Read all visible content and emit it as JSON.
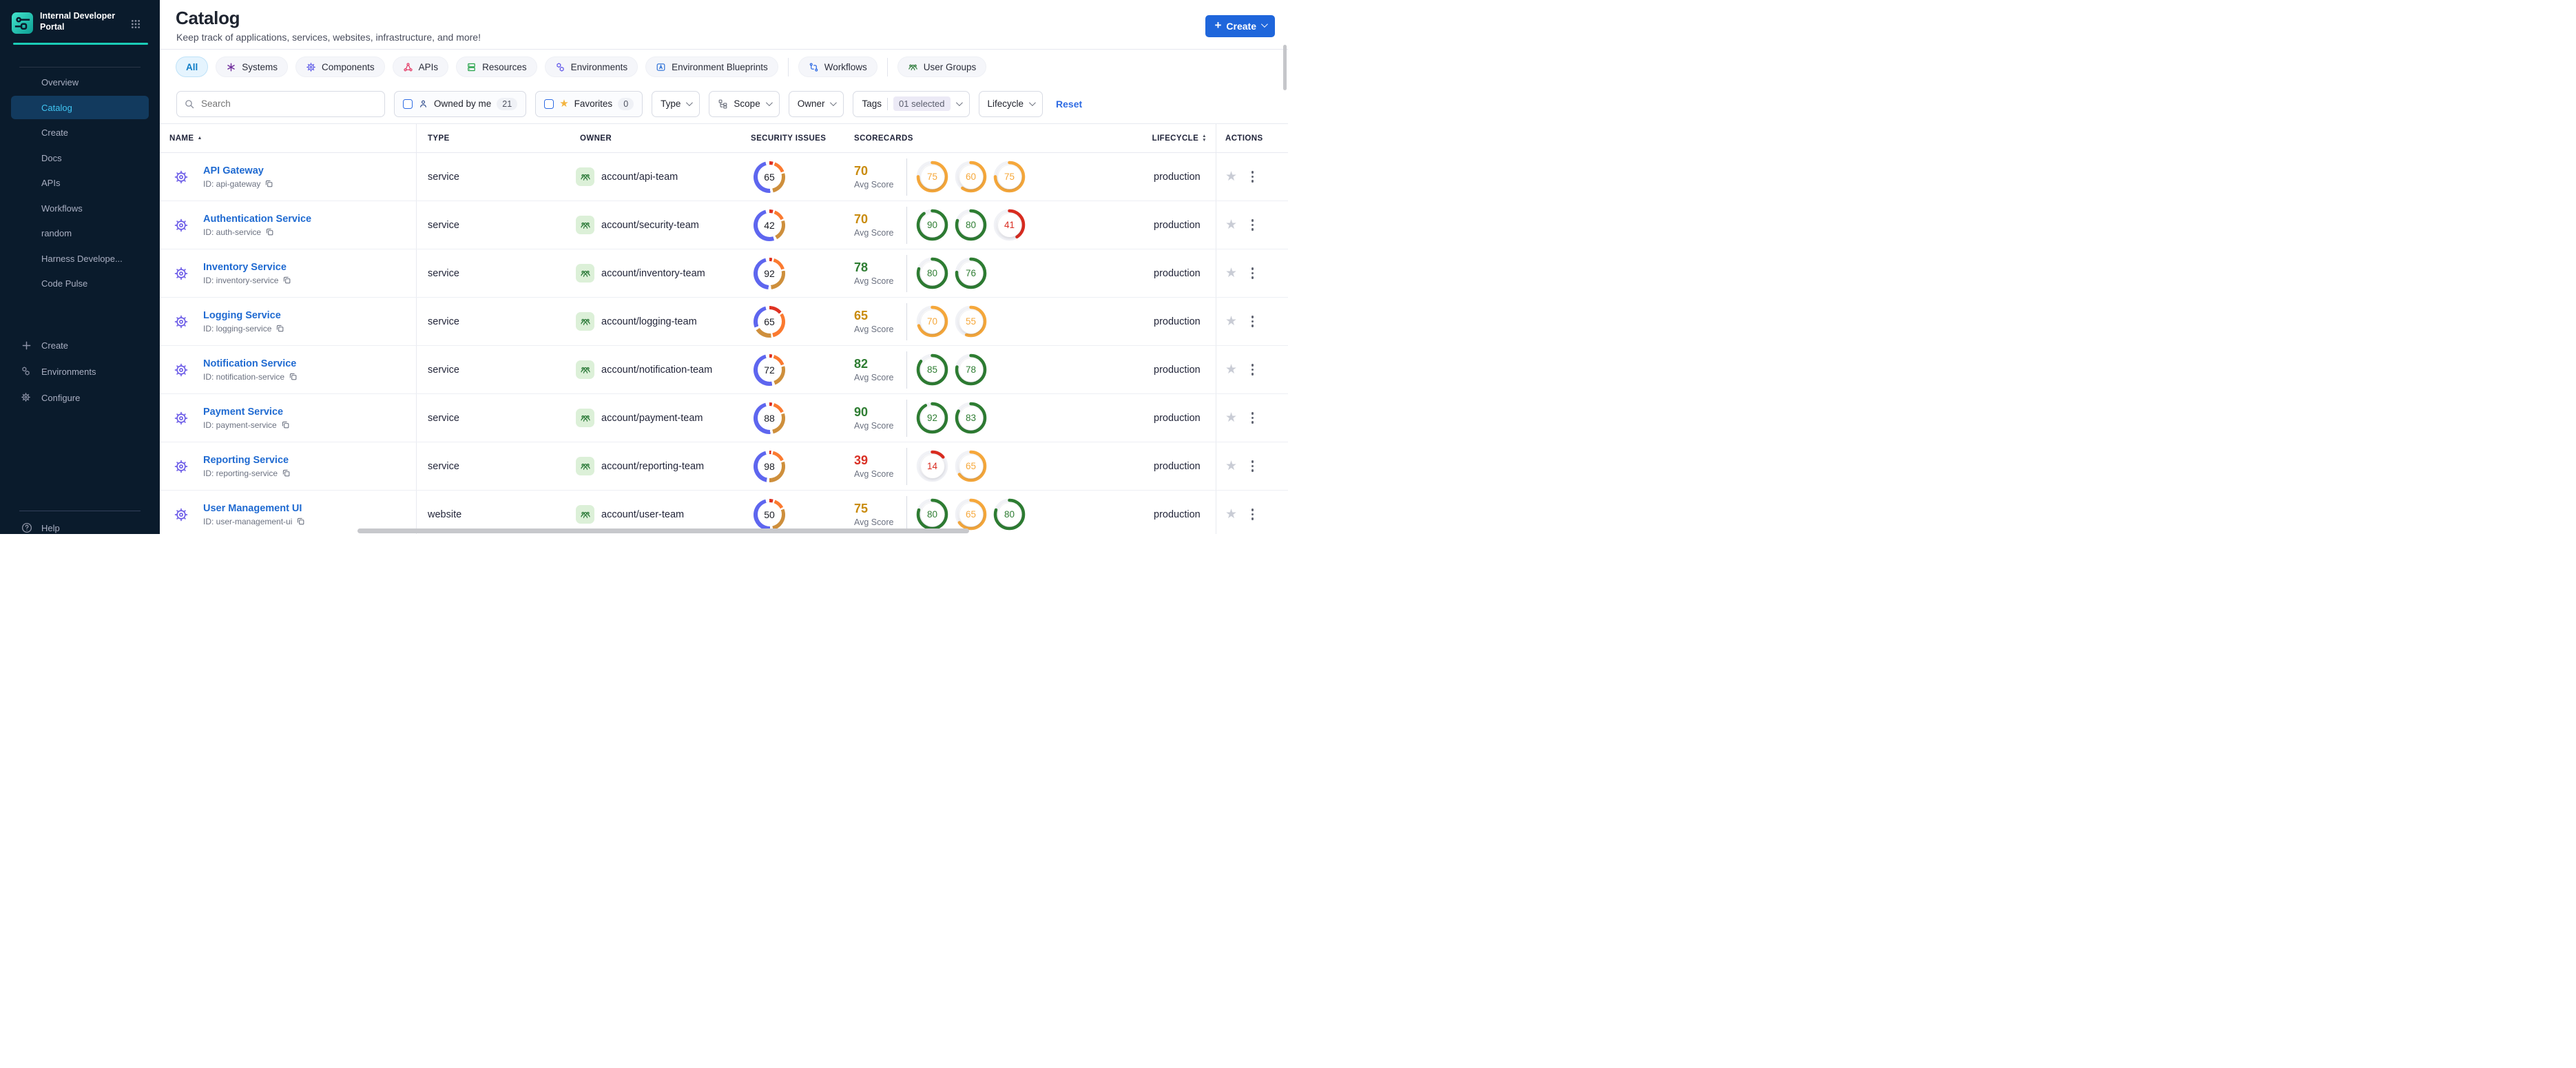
{
  "colors": {
    "accent_blue": "#1F66DB",
    "link_blue": "#1F6AD1",
    "sidebar_bg": "#0A1B2C",
    "teal": "#1BCDB7",
    "active_nav": "#40C6F3",
    "ring_green": "#2E7D32",
    "ring_orange": "#F6A83B",
    "ring_red": "#D92C20",
    "text_green": "#2E7D32",
    "text_orange": "#C98B0E",
    "text_red": "#D93025",
    "donut_blue": "#5E66EF",
    "donut_red": "#DF3222",
    "donut_orange": "#FB7A30",
    "donut_amber": "#CE8F3C"
  },
  "sidebar": {
    "title": "Internal Developer Portal",
    "nav": [
      {
        "label": "Overview",
        "active": false
      },
      {
        "label": "Catalog",
        "active": true
      },
      {
        "label": "Create",
        "active": false
      },
      {
        "label": "Docs",
        "active": false
      },
      {
        "label": "APIs",
        "active": false
      },
      {
        "label": "Workflows",
        "active": false
      },
      {
        "label": "random",
        "active": false
      },
      {
        "label": "Harness Develope...",
        "active": false
      },
      {
        "label": "Code Pulse",
        "active": false
      }
    ],
    "bottom": [
      {
        "icon": "plus",
        "label": "Create"
      },
      {
        "icon": "hexagons",
        "label": "Environments"
      },
      {
        "icon": "gear",
        "label": "Configure"
      }
    ],
    "help": "Help"
  },
  "header": {
    "title": "Catalog",
    "subtitle": "Keep track of applications, services, websites, infrastructure, and more!",
    "create_label": "Create"
  },
  "tabs": [
    {
      "label": "All",
      "icon": null,
      "color": null,
      "active": true,
      "divider_before": false
    },
    {
      "label": "Systems",
      "icon": "systems",
      "color": "#6E2A9B",
      "active": false,
      "divider_before": false
    },
    {
      "label": "Components",
      "icon": "gear",
      "color": "#5F5CE8",
      "active": false,
      "divider_before": false
    },
    {
      "label": "APIs",
      "icon": "apis",
      "color": "#E43A66",
      "active": false,
      "divider_before": false
    },
    {
      "label": "Resources",
      "icon": "resources",
      "color": "#27A34A",
      "active": false,
      "divider_before": false
    },
    {
      "label": "Environments",
      "icon": "hexagons",
      "color": "#5B51E8",
      "active": false,
      "divider_before": false
    },
    {
      "label": "Environment Blueprints",
      "icon": "blueprints",
      "color": "#2A6FD6",
      "active": false,
      "divider_before": false
    },
    {
      "label": "Workflows",
      "icon": "workflows",
      "color": "#2E6BE4",
      "active": false,
      "divider_before": true
    },
    {
      "label": "User Groups",
      "icon": "usergroups",
      "color": "#2C7A39",
      "active": false,
      "divider_before": true
    }
  ],
  "filters": {
    "search_placeholder": "Search",
    "owned_by_me": "Owned by me",
    "owned_count": "21",
    "favorites": "Favorites",
    "favorites_count": "0",
    "type": "Type",
    "scope": "Scope",
    "owner": "Owner",
    "tags": "Tags",
    "tags_selected": "01 selected",
    "lifecycle": "Lifecycle",
    "reset": "Reset"
  },
  "table": {
    "columns": [
      {
        "label": "NAME",
        "sort": "asc"
      },
      {
        "label": "TYPE",
        "sort": null
      },
      {
        "label": "OWNER",
        "sort": null
      },
      {
        "label": "SECURITY ISSUES",
        "sort": null
      },
      {
        "label": "SCORECARDS",
        "sort": null
      },
      {
        "label": "LIFECYCLE",
        "sort": "both"
      },
      {
        "label": "ACTIONS",
        "sort": null
      }
    ],
    "avg_label": "Avg Score",
    "rows": [
      {
        "name": "API Gateway",
        "id": "ID: api-gateway",
        "type": "service",
        "owner": "account/api-team",
        "security": 65,
        "security_ring": [
          [
            "#DF3222",
            4
          ],
          [
            "#fff",
            2
          ],
          [
            "#FB7A30",
            13
          ],
          [
            "#fff",
            2
          ],
          [
            "#CE8F3C",
            25
          ],
          [
            "#fff",
            3
          ],
          [
            "#5E66EF",
            47
          ],
          [
            "#fff",
            4
          ]
        ],
        "avg": 70,
        "avg_color": "orange",
        "scorecards": [
          {
            "v": 75,
            "c": "orange"
          },
          {
            "v": 60,
            "c": "orange"
          },
          {
            "v": 75,
            "c": "orange"
          }
        ],
        "lifecycle": "production"
      },
      {
        "name": "Authentication Service",
        "id": "ID: auth-service",
        "type": "service",
        "owner": "account/security-team",
        "security": 42,
        "security_ring": [
          [
            "#DF3222",
            4
          ],
          [
            "#fff",
            2
          ],
          [
            "#FB7A30",
            12
          ],
          [
            "#fff",
            2
          ],
          [
            "#CE8F3C",
            22
          ],
          [
            "#fff",
            3
          ],
          [
            "#5E66EF",
            51
          ],
          [
            "#fff",
            4
          ]
        ],
        "avg": 70,
        "avg_color": "orange",
        "scorecards": [
          {
            "v": 90,
            "c": "green"
          },
          {
            "v": 80,
            "c": "green"
          },
          {
            "v": 41,
            "c": "red"
          }
        ],
        "lifecycle": "production"
      },
      {
        "name": "Inventory Service",
        "id": "ID: inventory-service",
        "type": "service",
        "owner": "account/inventory-team",
        "security": 92,
        "security_ring": [
          [
            "#DF3222",
            3
          ],
          [
            "#fff",
            2
          ],
          [
            "#FB7A30",
            15
          ],
          [
            "#fff",
            2
          ],
          [
            "#CE8F3C",
            26
          ],
          [
            "#fff",
            3
          ],
          [
            "#5E66EF",
            45
          ],
          [
            "#fff",
            4
          ]
        ],
        "avg": 78,
        "avg_color": "green",
        "scorecards": [
          {
            "v": 80,
            "c": "green"
          },
          {
            "v": 76,
            "c": "green"
          }
        ],
        "lifecycle": "production"
      },
      {
        "name": "Logging Service",
        "id": "ID: logging-service",
        "type": "service",
        "owner": "account/logging-team",
        "security": 65,
        "security_ring": [
          [
            "#DF3222",
            14
          ],
          [
            "#fff",
            2
          ],
          [
            "#FB7A30",
            30
          ],
          [
            "#fff",
            2
          ],
          [
            "#CE8F3C",
            18
          ],
          [
            "#fff",
            3
          ],
          [
            "#5E66EF",
            27
          ],
          [
            "#fff",
            4
          ]
        ],
        "avg": 65,
        "avg_color": "orange",
        "scorecards": [
          {
            "v": 70,
            "c": "orange"
          },
          {
            "v": 55,
            "c": "orange"
          }
        ],
        "lifecycle": "production"
      },
      {
        "name": "Notification Service",
        "id": "ID: notification-service",
        "type": "service",
        "owner": "account/notification-team",
        "security": 72,
        "security_ring": [
          [
            "#DF3222",
            3
          ],
          [
            "#fff",
            2
          ],
          [
            "#FB7A30",
            14
          ],
          [
            "#fff",
            2
          ],
          [
            "#CE8F3C",
            23
          ],
          [
            "#fff",
            3
          ],
          [
            "#5E66EF",
            49
          ],
          [
            "#fff",
            4
          ]
        ],
        "avg": 82,
        "avg_color": "green",
        "scorecards": [
          {
            "v": 85,
            "c": "green"
          },
          {
            "v": 78,
            "c": "green"
          }
        ],
        "lifecycle": "production"
      },
      {
        "name": "Payment Service",
        "id": "ID: payment-service",
        "type": "service",
        "owner": "account/payment-team",
        "security": 88,
        "security_ring": [
          [
            "#DF3222",
            3
          ],
          [
            "#fff",
            2
          ],
          [
            "#FB7A30",
            13
          ],
          [
            "#fff",
            2
          ],
          [
            "#CE8F3C",
            26
          ],
          [
            "#fff",
            3
          ],
          [
            "#5E66EF",
            47
          ],
          [
            "#fff",
            4
          ]
        ],
        "avg": 90,
        "avg_color": "green",
        "scorecards": [
          {
            "v": 92,
            "c": "green"
          },
          {
            "v": 83,
            "c": "green"
          }
        ],
        "lifecycle": "production"
      },
      {
        "name": "Reporting Service",
        "id": "ID: reporting-service",
        "type": "service",
        "owner": "account/reporting-team",
        "security": 98,
        "security_ring": [
          [
            "#DF3222",
            2
          ],
          [
            "#fff",
            2
          ],
          [
            "#FB7A30",
            14
          ],
          [
            "#fff",
            2
          ],
          [
            "#CE8F3C",
            30
          ],
          [
            "#fff",
            3
          ],
          [
            "#5E66EF",
            43
          ],
          [
            "#fff",
            4
          ]
        ],
        "avg": 39,
        "avg_color": "red",
        "scorecards": [
          {
            "v": 14,
            "c": "red"
          },
          {
            "v": 65,
            "c": "orange"
          }
        ],
        "lifecycle": "production"
      },
      {
        "name": "User Management UI",
        "id": "ID: user-management-ui",
        "type": "website",
        "owner": "account/user-team",
        "security": 50,
        "security_ring": [
          [
            "#DF3222",
            4
          ],
          [
            "#fff",
            2
          ],
          [
            "#FB7A30",
            11
          ],
          [
            "#fff",
            2
          ],
          [
            "#CE8F3C",
            27
          ],
          [
            "#fff",
            3
          ],
          [
            "#5E66EF",
            47
          ],
          [
            "#fff",
            4
          ]
        ],
        "avg": 75,
        "avg_color": "orange",
        "scorecards": [
          {
            "v": 80,
            "c": "green"
          },
          {
            "v": 65,
            "c": "orange"
          },
          {
            "v": 80,
            "c": "green"
          }
        ],
        "lifecycle": "production"
      }
    ]
  }
}
